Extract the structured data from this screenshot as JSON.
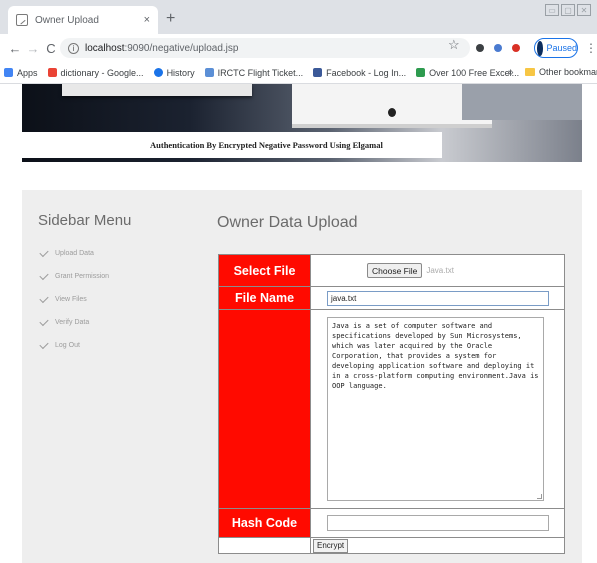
{
  "browser": {
    "tab_title": "Owner Upload",
    "tab_close": "×",
    "new_tab": "+",
    "window_controls": [
      "▭",
      "▢",
      "✕"
    ],
    "nav": {
      "back": "←",
      "forward": "→",
      "reload": "C"
    },
    "url_host": "localhost",
    "url_rest": ":9090/negative/upload.jsp",
    "star": "☆",
    "profile_label": "Paused",
    "menu": "⋮"
  },
  "bookmarks": {
    "items": [
      {
        "label": "Apps",
        "color": "#4285f4"
      },
      {
        "label": "dictionary - Google...",
        "color": "#ea4335"
      },
      {
        "label": "History",
        "color": "#1a73e8"
      },
      {
        "label": "IRCTC Flight Ticket...",
        "color": "#5b8fd6"
      },
      {
        "label": "Facebook - Log In...",
        "color": "#3b5998"
      },
      {
        "label": "Over 100 Free Excel...",
        "color": "#2e9b4f"
      }
    ],
    "more": "»",
    "other": "Other bookmarks"
  },
  "page": {
    "banner_caption": "Authentication By Encrypted Negative Password Using Elgamal",
    "sidebar": {
      "title": "Sidebar Menu",
      "items": [
        "Upload Data",
        "Grant Permission",
        "View Files",
        "Verify Data",
        "Log Out"
      ]
    },
    "main_title": "Owner Data Upload",
    "form": {
      "select_file_label": "Select File",
      "choose_file_button": "Choose File",
      "chosen_file": "Java.txt",
      "file_name_label": "File Name",
      "file_name_value": "java.txt",
      "content": "Java is a set of computer software and specifications developed by Sun Microsystems, which was later acquired by the Oracle Corporation, that provides a system for developing application software and deploying it in a cross-platform computing environment.Java is OOP language.",
      "hash_code_label": "Hash Code",
      "hash_code_value": "",
      "encrypt_button": "Encrypt"
    }
  },
  "colors": {
    "label_red": "#ff0a00",
    "content_bg": "#eeeeee"
  }
}
